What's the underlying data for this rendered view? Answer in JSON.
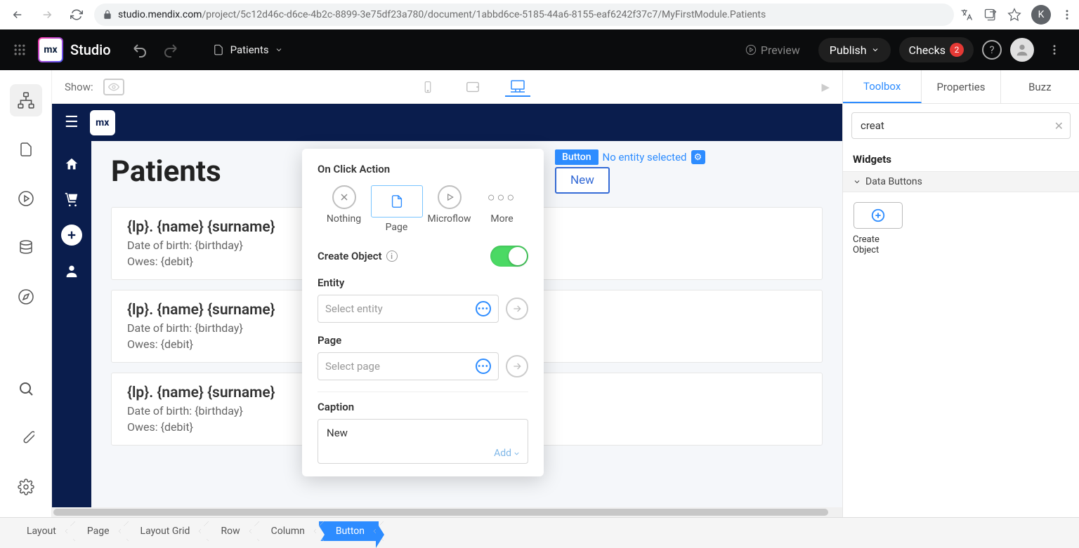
{
  "browser": {
    "url_domain": "studio.mendix.com",
    "url_rest": "/project/5c12d46c-d6ce-4b2c-8899-3e75df23a780/document/1abbd6ce-5185-44a6-8155-eaf6242f37c7/MyFirstModule.Patients",
    "avatar": "K"
  },
  "studio": {
    "title": "Studio",
    "doc_name": "Patients",
    "preview": "Preview",
    "publish": "Publish",
    "checks": "Checks",
    "checks_count": "2"
  },
  "device_bar": {
    "show": "Show:"
  },
  "page": {
    "title": "Patients",
    "card_heading": "{lp}. {name} {surname}",
    "card_line1": "Date of birth: {birthday}",
    "card_line2": "Owes: {debit}"
  },
  "selected": {
    "badge": "Button",
    "subtitle": "No entity selected",
    "button_text": "New"
  },
  "panel": {
    "title": "On Click Action",
    "opt_nothing": "Nothing",
    "opt_page": "Page",
    "opt_microflow": "Microflow",
    "opt_more": "More",
    "create_object": "Create Object",
    "entity_label": "Entity",
    "entity_placeholder": "Select entity",
    "page_label": "Page",
    "page_placeholder": "Select page",
    "caption_label": "Caption",
    "caption_value": "New",
    "add_label": "Add"
  },
  "right": {
    "tabs": {
      "toolbox": "Toolbox",
      "properties": "Properties",
      "buzz": "Buzz"
    },
    "search": "creat",
    "widgets_header": "Widgets",
    "group": "Data Buttons",
    "widget_label": "Create Object"
  },
  "breadcrumb": {
    "items": [
      "Layout",
      "Page",
      "Layout Grid",
      "Row",
      "Column",
      "Button"
    ]
  }
}
